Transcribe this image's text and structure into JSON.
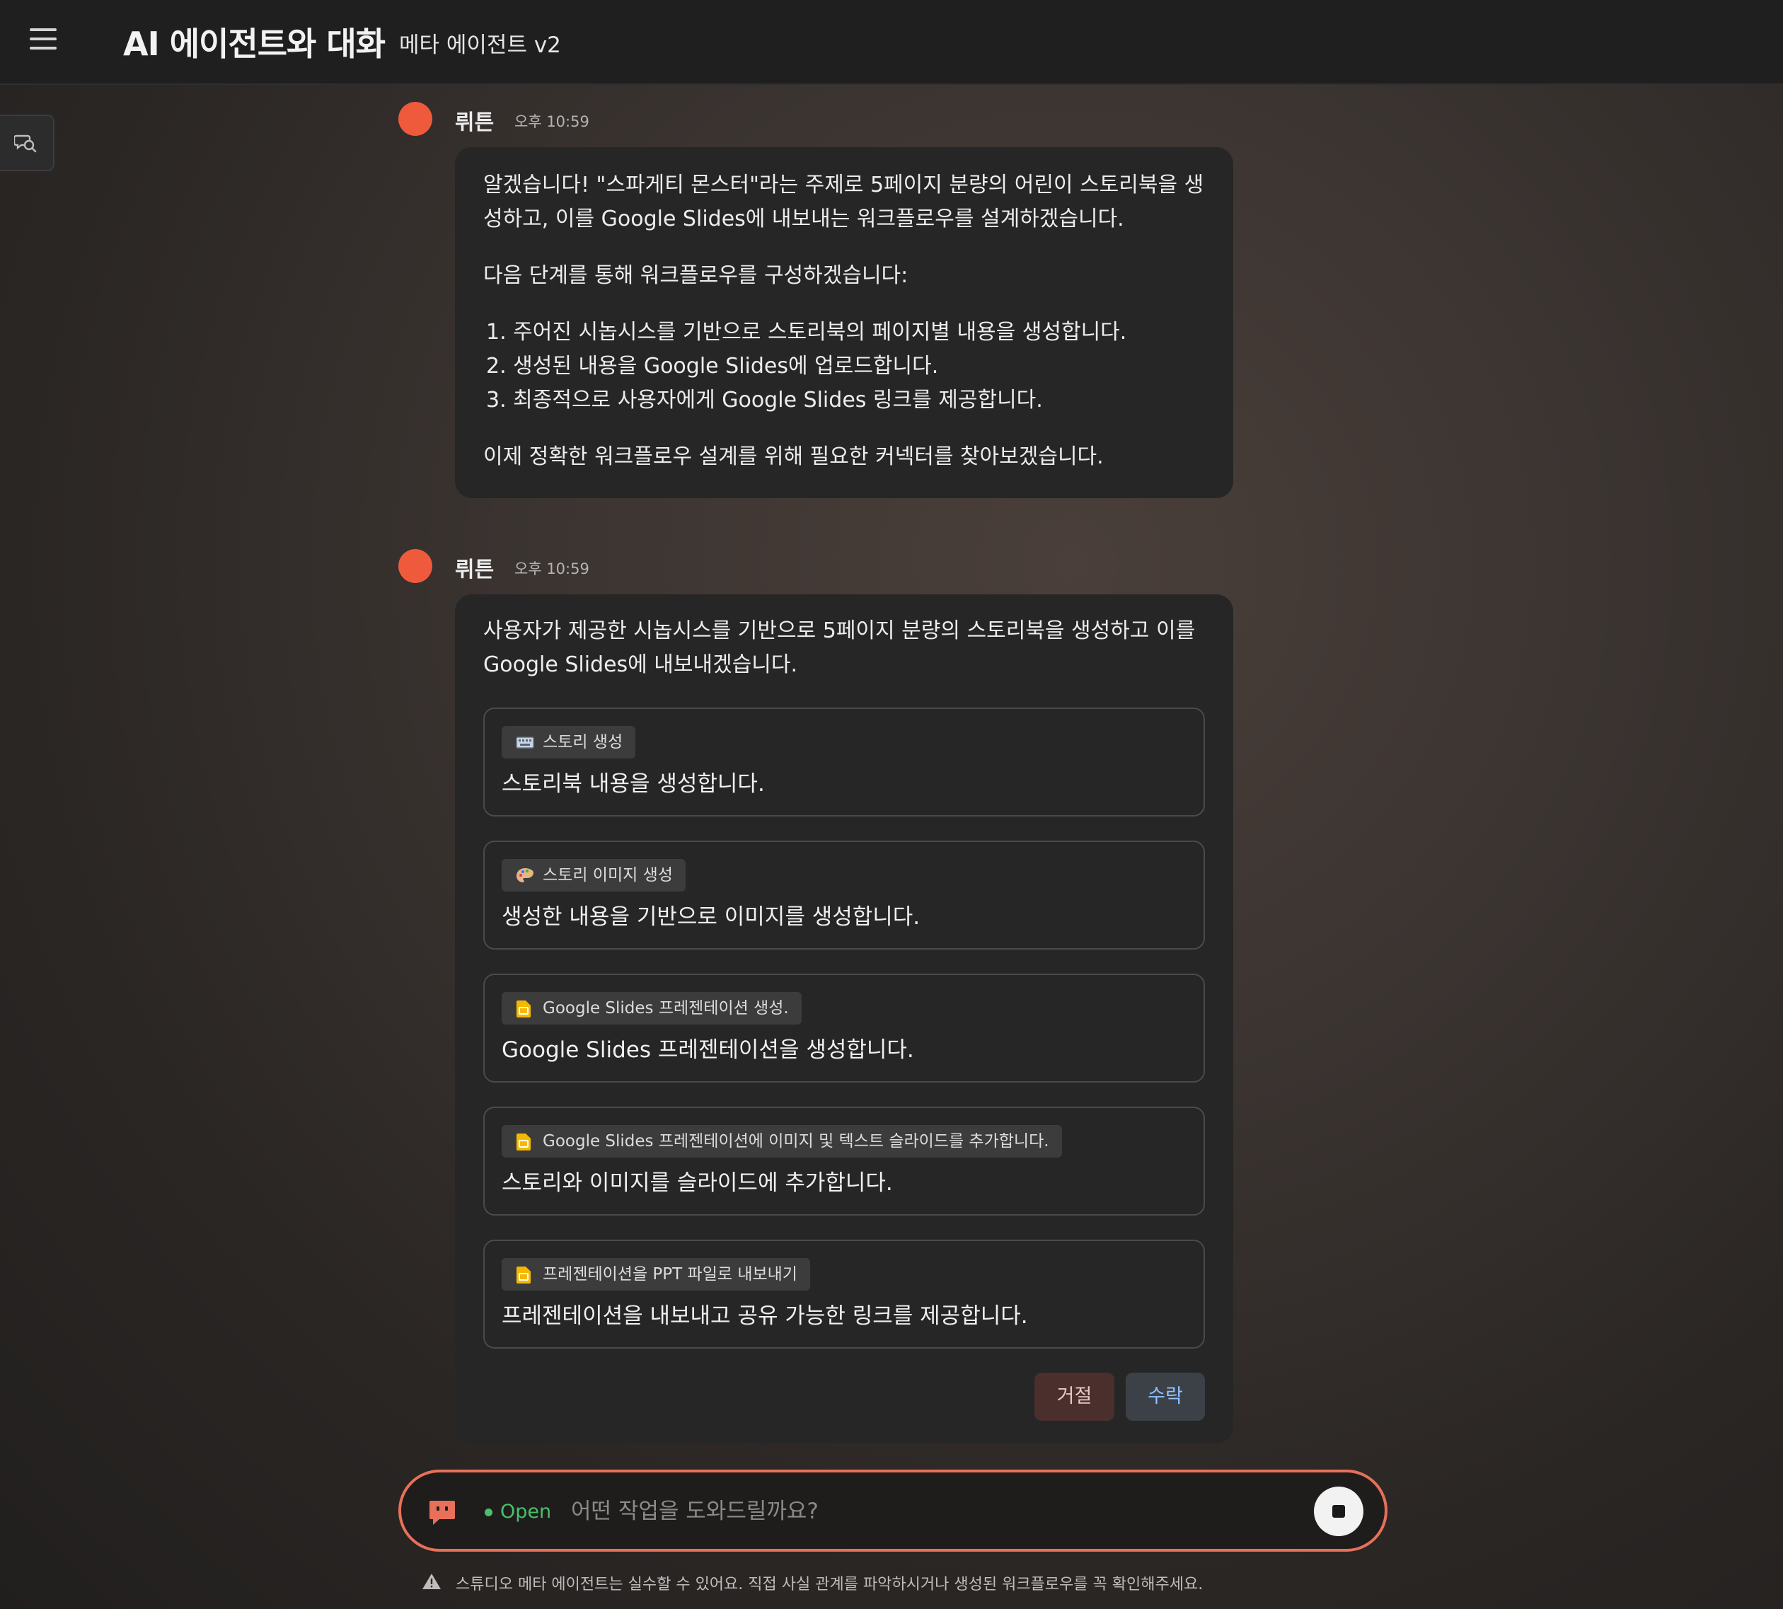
{
  "header": {
    "title": "AI 에이전트와 대화",
    "subtitle": "메타 에이전트 v2",
    "menu_icon": "hamburger-icon"
  },
  "sidebar_toggle": {
    "icon": "chat-search-icon"
  },
  "messages": [
    {
      "sender": "뤼튼",
      "time": "오후 10:59",
      "paragraphs": [
        "알겠습니다! \"스파게티 몬스터\"라는 주제로 5페이지 분량의 어린이 스토리북을 생성하고, 이를 Google Slides에 내보내는 워크플로우를 설계하겠습니다.",
        "다음 단계를 통해 워크플로우를 구성하겠습니다:",
        "이제 정확한 워크플로우 설계를 위해 필요한 커넥터를 찾아보겠습니다."
      ],
      "list": [
        "1. 주어진 시놉시스를 기반으로 스토리북의 페이지별 내용을 생성합니다.",
        "2. 생성된 내용을 Google Slides에 업로드합니다.",
        "3. 최종적으로 사용자에게 Google Slides 링크를 제공합니다."
      ]
    },
    {
      "sender": "뤼튼",
      "time": "오후 10:59",
      "intro": "사용자가 제공한 시놉시스를 기반으로 5페이지 분량의 스토리북을 생성하고 이를 Google Slides에 내보내겠습니다.",
      "steps": [
        {
          "tool": "스토리 생성",
          "icon": "keyboard-icon",
          "description": "스토리북 내용을 생성합니다."
        },
        {
          "tool": "스토리 이미지 생성",
          "icon": "palette-icon",
          "description": "생성한 내용을 기반으로 이미지를 생성합니다."
        },
        {
          "tool": "Google Slides 프레젠테이션 생성.",
          "icon": "google-slides-icon",
          "description": "Google Slides 프레젠테이션을 생성합니다."
        },
        {
          "tool": "Google Slides 프레젠테이션에 이미지 및 텍스트 슬라이드를 추가합니다.",
          "icon": "google-slides-icon",
          "description": "스토리와 이미지를 슬라이드에 추가합니다."
        },
        {
          "tool": "프레젠테이션을 PPT 파일로 내보내기",
          "icon": "google-slides-icon",
          "description": "프레젠테이션을 내보내고 공유 가능한 링크를 제공합니다."
        }
      ],
      "reject_label": "거절",
      "accept_label": "수락"
    }
  ],
  "composer": {
    "status": "Open",
    "placeholder": "어떤 작업을 도와드릴까요?",
    "chat_icon": "chat-bubble-icon",
    "stop_icon": "stop-icon"
  },
  "disclaimer": "스튜디오 메타 에이전트는 실수할 수 있어요. 직접 사실 관계를 파악하시거나 생성된 워크플로우를 꼭 확인해주세요.",
  "colors": {
    "accent": "#ef5a3c",
    "status_open": "#49c06a",
    "accept_text": "#8ec3ff",
    "reject_bg": "#4a2f2c"
  }
}
